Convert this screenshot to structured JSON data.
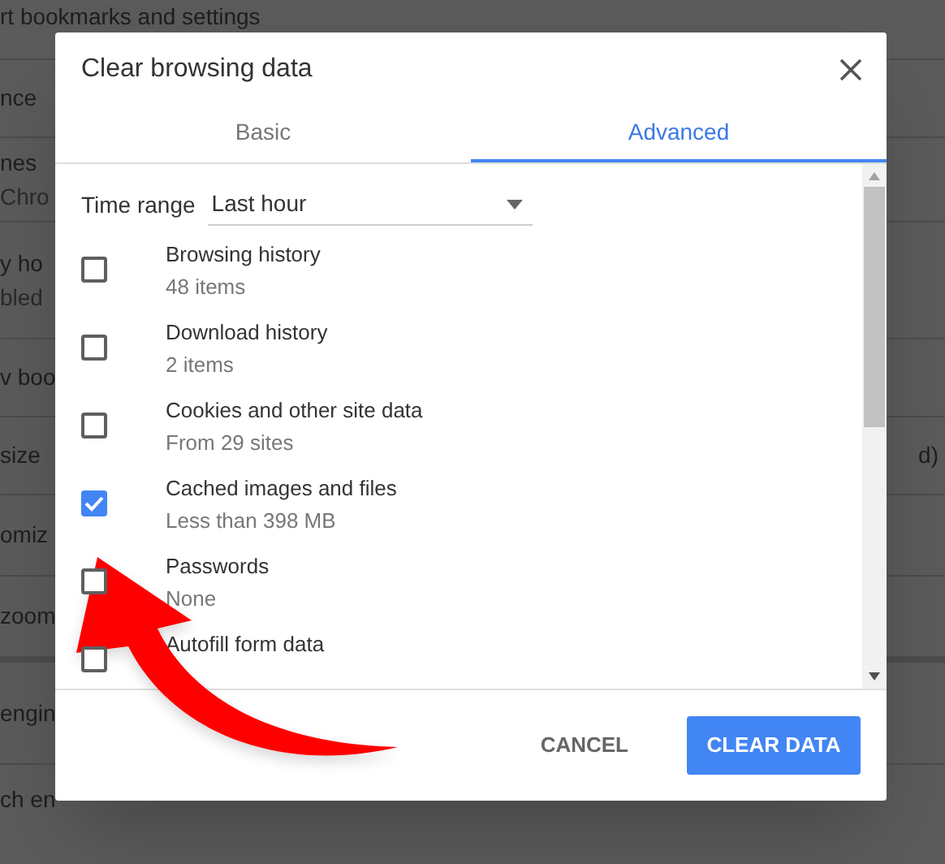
{
  "background": {
    "header": "rt bookmarks and settings",
    "rows": [
      {
        "lines": [
          "nce"
        ]
      },
      {
        "lines": [
          "nes",
          "Chro"
        ]
      },
      {
        "lines": [
          "y ho",
          "bled"
        ]
      },
      {
        "lines": [
          "v boo"
        ]
      },
      {
        "lines": [
          "size"
        ],
        "trailing": "d)"
      },
      {
        "lines": [
          "omiz"
        ]
      },
      {
        "lines": [
          "zoom"
        ]
      },
      {
        "lines": [
          "engin"
        ]
      },
      {
        "lines": [
          "ch en"
        ]
      }
    ]
  },
  "dialog": {
    "title": "Clear browsing data",
    "tabs": [
      {
        "label": "Basic",
        "selected": false
      },
      {
        "label": "Advanced",
        "selected": true
      }
    ],
    "time_range": {
      "label": "Time range",
      "value": "Last hour"
    },
    "items": [
      {
        "label": "Browsing history",
        "detail": "48 items",
        "checked": false
      },
      {
        "label": "Download history",
        "detail": "2 items",
        "checked": false
      },
      {
        "label": "Cookies and other site data",
        "detail": "From 29 sites",
        "checked": false
      },
      {
        "label": "Cached images and files",
        "detail": "Less than 398 MB",
        "checked": true
      },
      {
        "label": "Passwords",
        "detail": "None",
        "checked": false
      },
      {
        "label": "Autofill form data",
        "checked": false
      }
    ],
    "buttons": [
      {
        "label": "CANCEL",
        "kind": "text"
      },
      {
        "label": "CLEAR DATA",
        "kind": "primary"
      }
    ]
  }
}
